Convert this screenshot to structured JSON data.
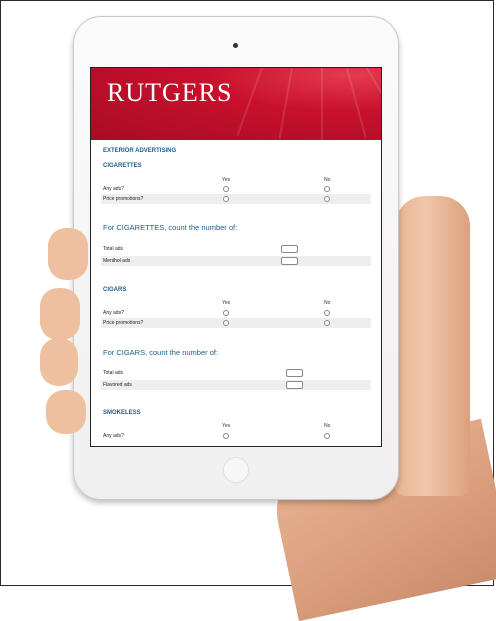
{
  "brand": {
    "logo_text": "RUTGERS",
    "color": "#c8102e"
  },
  "survey": {
    "section_title": "EXTERIOR ADVERTISING",
    "col_yes": "Yes",
    "col_no": "No",
    "cigarettes": {
      "title": "CIGARETTES",
      "q1": "Any ads?",
      "q2": "Price promotions?"
    },
    "cigarettes_count": {
      "title": "For CIGARETTES, count the number of:",
      "r1": "Total ads",
      "r2": "Menthol ads"
    },
    "cigars": {
      "title": "CIGARS",
      "q1": "Any ads?",
      "q2": "Price promotions?"
    },
    "cigars_count": {
      "title": "For CIGARS, count the number of:",
      "r1": "Total ads",
      "r2": "Flavored ads"
    },
    "smokeless": {
      "title": "SMOKELESS",
      "q1": "Any ads?"
    }
  },
  "colors": {
    "heading": "#1c5d8a",
    "row_alt": "#eeeeee"
  }
}
